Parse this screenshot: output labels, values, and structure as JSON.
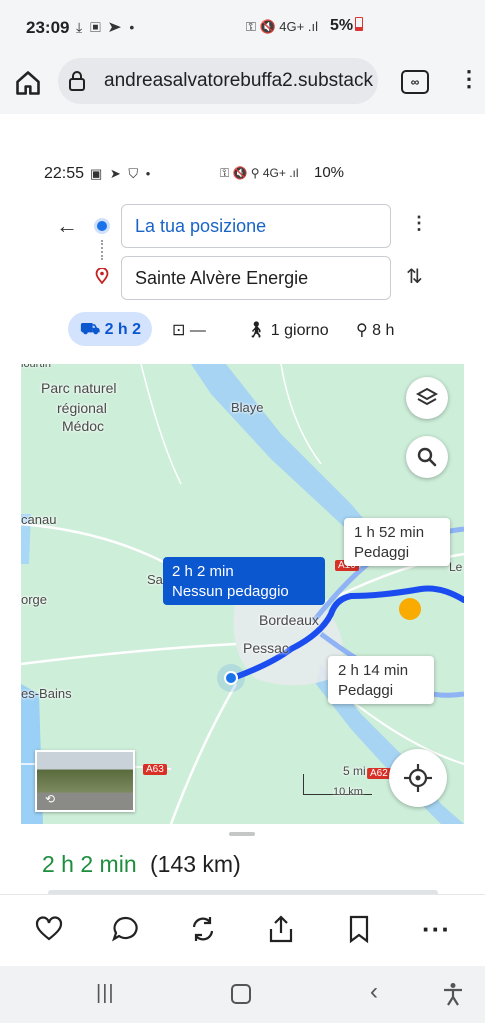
{
  "status_bar": {
    "time": "23:09",
    "icons": "⤓ ▣ ➤ •",
    "right_icons": "⚿ 🔇 4G+ .ıl",
    "battery": "5%"
  },
  "browser": {
    "url": "andreasalvatorebuffa2.substack",
    "tabs_icon": "∞",
    "home_icon": "home-icon",
    "lock_icon": "lock-icon"
  },
  "inner_status": {
    "time": "22:55",
    "icons": "▣ ➤ ⛉ •",
    "right_icons": "⚿ 🔇 ⚲ 4G+ .ıl",
    "battery": "10%"
  },
  "directions": {
    "origin": "La tua posizione",
    "destination": "Sainte Alvère Energie",
    "modes": [
      {
        "icon": "car-icon",
        "label": "2 h 2"
      },
      {
        "icon": "transit-icon",
        "label": "—"
      },
      {
        "icon": "walk-icon",
        "label": "1 giorno"
      },
      {
        "icon": "bike-icon",
        "label": "8 h"
      }
    ]
  },
  "map": {
    "labels": {
      "parc1": "Parc naturel",
      "parc2": "régional",
      "parc3": "Médoc",
      "blaye": "Blaye",
      "lacanau": "canau",
      "sa": "Sa",
      "orge": "orge",
      "bordeaux": "Bordeaux",
      "pessac": "Pessac",
      "bains": "es-Bains",
      "hourtin": "lourtin",
      "a63": "A63",
      "a62": "A62",
      "a10": "A10",
      "le": "Le",
      "scale_mi": "5 mi",
      "scale_km": "10 km"
    },
    "route_main": {
      "time": "2 h 2 min",
      "note": "Nessun pedaggio"
    },
    "route_alt1": {
      "time": "1 h 52 min",
      "note": "Pedaggi"
    },
    "route_alt2": {
      "time": "2 h 14 min",
      "note": "Pedaggi"
    }
  },
  "summary": {
    "duration": "2 h 2 min",
    "distance": "(143 km)"
  },
  "colors": {
    "route": "#1a4cf0",
    "accent": "#1a73e8",
    "duration": "#1e8e3e",
    "map_land": "#c9ecd6"
  }
}
